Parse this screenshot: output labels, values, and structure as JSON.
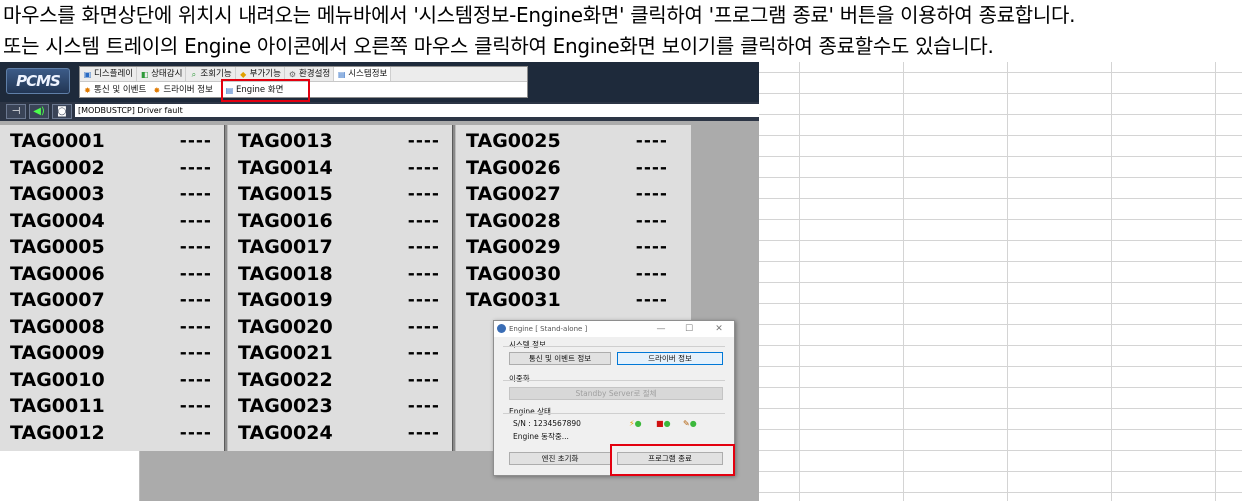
{
  "instructions": {
    "line1": "마우스를 화면상단에 위치시 내려오는 메뉴바에서 '시스템정보-Engine화면' 클릭하여 '프로그램 종료' 버튼을 이용하여 종료합니다.",
    "line2": "또는 시스템 트레이의 Engine 아이콘에서 오른쪽 마우스 클릭하여 Engine화면 보이기를 클릭하여 종료할수도 있습니다."
  },
  "app": {
    "logo": "PCMS",
    "menu_tabs": [
      {
        "label": "디스플레이",
        "icon": "display-icon"
      },
      {
        "label": "상태감시",
        "icon": "monitor-icon"
      },
      {
        "label": "조회기능",
        "icon": "search-icon"
      },
      {
        "label": "부가기능",
        "icon": "addon-icon"
      },
      {
        "label": "환경설정",
        "icon": "settings-icon"
      },
      {
        "label": "시스템정보",
        "icon": "system-icon"
      }
    ],
    "submenu_items": [
      {
        "label": "통신 및 이벤트",
        "icon": "comm-icon"
      },
      {
        "label": "드라이버 정보",
        "icon": "driver-icon"
      },
      {
        "label": "Engine 화면",
        "icon": "engine-screen-icon"
      }
    ],
    "toolbar_icons": [
      "pin-icon",
      "speaker-icon",
      "camera-icon"
    ],
    "status_message": "[MODBUSTCP] Driver fault",
    "tag_columns": [
      [
        "TAG0001",
        "TAG0002",
        "TAG0003",
        "TAG0004",
        "TAG0005",
        "TAG0006",
        "TAG0007",
        "TAG0008",
        "TAG0009",
        "TAG0010",
        "TAG0011",
        "TAG0012"
      ],
      [
        "TAG0013",
        "TAG0014",
        "TAG0015",
        "TAG0016",
        "TAG0017",
        "TAG0018",
        "TAG0019",
        "TAG0020",
        "TAG0021",
        "TAG0022",
        "TAG0023",
        "TAG0024"
      ],
      [
        "TAG0025",
        "TAG0026",
        "TAG0027",
        "TAG0028",
        "TAG0029",
        "TAG0030",
        "TAG0031"
      ]
    ],
    "tag_value": "----"
  },
  "dialog": {
    "title": "Engine [ Stand-alone ]",
    "minimize": "—",
    "maximize": "☐",
    "close": "✕",
    "system_info_label": "시스템 정보",
    "comm_button": "통신 및 이벤트 정보",
    "driver_button": "드라이버 정보",
    "redundancy_label": "이중화",
    "standby_button": "Standby Server로 절체",
    "engine_status_label": "Engine 상태",
    "serial": "S/N : 1234567890",
    "running": "Engine 동작중...",
    "reset_button": "엔진 초기화",
    "exit_button": "프로그램 종료"
  }
}
